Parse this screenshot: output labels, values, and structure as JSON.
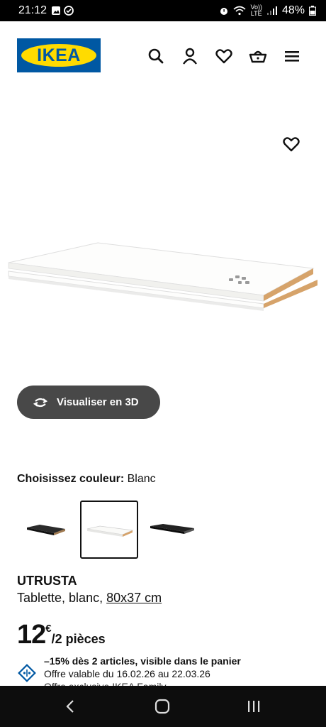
{
  "status_bar": {
    "time": "21:12",
    "network_label_top": "Vo))",
    "network_label_bottom": "LTE",
    "battery": "48%"
  },
  "header": {
    "logo_text": "IKEA",
    "icons": [
      "search-icon",
      "user-icon",
      "heart-icon",
      "basket-icon",
      "menu-icon"
    ]
  },
  "product": {
    "view_3d_label": "Visualiser en 3D",
    "color_label": "Choisissez couleur:",
    "color_value": "Blanc",
    "swatches": [
      "black-shelf",
      "white-shelf",
      "dark-shelf"
    ],
    "selected_swatch": 1,
    "brand": "UTRUSTA",
    "description": "Tablette, blanc,",
    "size": "80x37 cm",
    "price_amount": "12",
    "price_currency": "€",
    "price_unit": "/2 pièces",
    "promo_line1": "–15% dès 2 articles, visible dans le panier",
    "promo_line2": "Offre valable du 16.02.26 au 22.03.26",
    "promo_line3": "Offre exclusive IKEA Family"
  },
  "colors": {
    "ikea_blue": "#0058a3",
    "ikea_yellow": "#ffdb00",
    "button_dark": "#484848",
    "promo_icon": "#0058a3"
  }
}
